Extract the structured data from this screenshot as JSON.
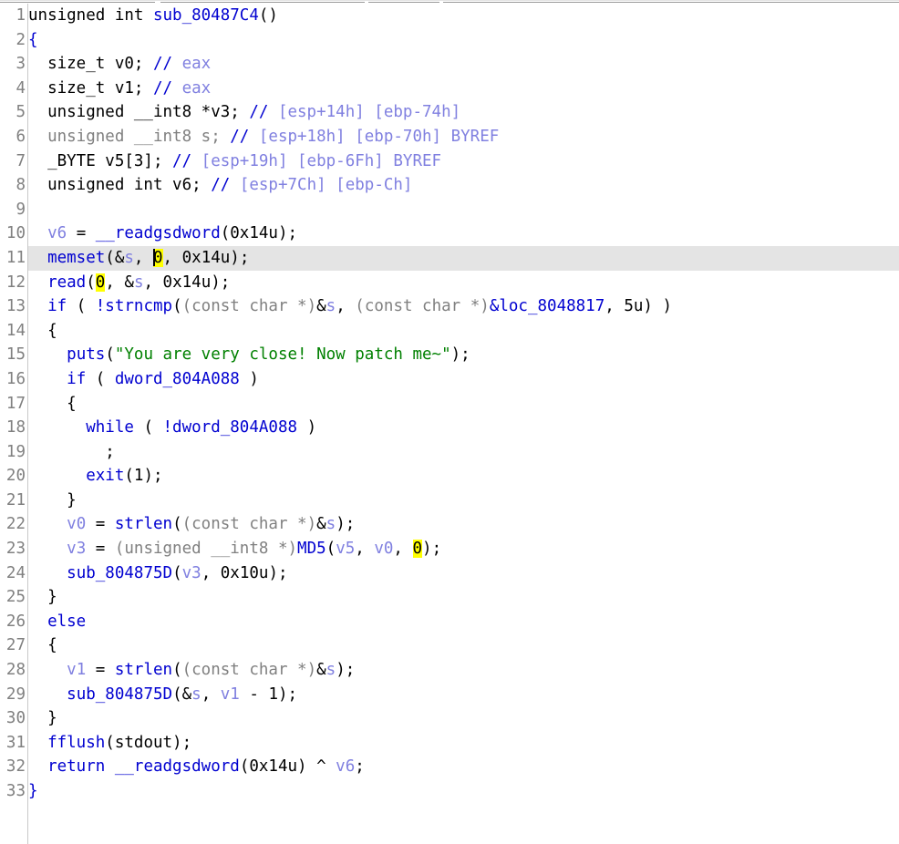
{
  "view": {
    "name": "pseudocode-view",
    "app": "IDA Pro Pseudocode",
    "function_signature": "unsigned int sub_80487C4()",
    "current_line": 11,
    "caret_line": 11,
    "caret_column": 15
  },
  "colors": {
    "background": "#ffffff",
    "keyword": "#0000d0",
    "function": "#0000d0",
    "local_variable": "#8080e0",
    "comment": "#8080e0",
    "cast_type": "#808080",
    "string": "#008000",
    "highlight_row": "#e4e4e4",
    "highlight_token": "#ffff00",
    "line_number": "#808080",
    "gutter_rule": "#c8c8c8"
  },
  "lines": [
    {
      "n": "1",
      "tokens": [
        {
          "t": "unsigned int ",
          "c": "plain"
        },
        {
          "t": "sub_80487C4",
          "c": "fn"
        },
        {
          "t": "()",
          "c": "plain"
        }
      ]
    },
    {
      "n": "2",
      "tokens": [
        {
          "t": "{",
          "c": "kw"
        }
      ]
    },
    {
      "n": "3",
      "tokens": [
        {
          "t": "  ",
          "c": "plain"
        },
        {
          "t": "size_t ",
          "c": "plain"
        },
        {
          "t": "v0",
          "c": "plain"
        },
        {
          "t": "; ",
          "c": "plain"
        },
        {
          "t": "// ",
          "c": "kw"
        },
        {
          "t": "eax",
          "c": "cmt"
        }
      ]
    },
    {
      "n": "4",
      "tokens": [
        {
          "t": "  ",
          "c": "plain"
        },
        {
          "t": "size_t ",
          "c": "plain"
        },
        {
          "t": "v1",
          "c": "plain"
        },
        {
          "t": "; ",
          "c": "plain"
        },
        {
          "t": "// ",
          "c": "kw"
        },
        {
          "t": "eax",
          "c": "cmt"
        }
      ]
    },
    {
      "n": "5",
      "tokens": [
        {
          "t": "  ",
          "c": "plain"
        },
        {
          "t": "unsigned __int8 *v3; ",
          "c": "plain"
        },
        {
          "t": "// ",
          "c": "kw"
        },
        {
          "t": "[esp+14h] [ebp-74h]",
          "c": "cmt"
        }
      ]
    },
    {
      "n": "6",
      "tokens": [
        {
          "t": "  ",
          "c": "plain"
        },
        {
          "t": "unsigned __int8 s; ",
          "c": "gray"
        },
        {
          "t": "// ",
          "c": "kw"
        },
        {
          "t": "[esp+18h] [ebp-70h] BYREF",
          "c": "cmt"
        }
      ]
    },
    {
      "n": "7",
      "tokens": [
        {
          "t": "  ",
          "c": "plain"
        },
        {
          "t": "_BYTE v5[3]; ",
          "c": "plain"
        },
        {
          "t": "// ",
          "c": "kw"
        },
        {
          "t": "[esp+19h] [ebp-6Fh] BYREF",
          "c": "cmt"
        }
      ]
    },
    {
      "n": "8",
      "tokens": [
        {
          "t": "  ",
          "c": "plain"
        },
        {
          "t": "unsigned int v6; ",
          "c": "plain"
        },
        {
          "t": "// ",
          "c": "kw"
        },
        {
          "t": "[esp+7Ch] [ebp-Ch]",
          "c": "cmt"
        }
      ]
    },
    {
      "n": "9",
      "tokens": [
        {
          "t": "",
          "c": "plain"
        }
      ]
    },
    {
      "n": "10",
      "tokens": [
        {
          "t": "  ",
          "c": "plain"
        },
        {
          "t": "v6",
          "c": "var"
        },
        {
          "t": " = ",
          "c": "plain"
        },
        {
          "t": "__readgsdword",
          "c": "kw"
        },
        {
          "t": "(0x14u);",
          "c": "plain"
        }
      ]
    },
    {
      "n": "11",
      "tokens": [
        {
          "t": "  ",
          "c": "plain"
        },
        {
          "t": "memset",
          "c": "kw"
        },
        {
          "t": "(&",
          "c": "plain"
        },
        {
          "t": "s",
          "c": "var"
        },
        {
          "t": ", ",
          "c": "plain"
        },
        {
          "t": "|",
          "c": "caret"
        },
        {
          "t": "0",
          "c": "hl"
        },
        {
          "t": ", 0x14u);",
          "c": "plain"
        }
      ]
    },
    {
      "n": "12",
      "tokens": [
        {
          "t": "  ",
          "c": "plain"
        },
        {
          "t": "read",
          "c": "kw"
        },
        {
          "t": "(",
          "c": "plain"
        },
        {
          "t": "0",
          "c": "hl"
        },
        {
          "t": ", &",
          "c": "plain"
        },
        {
          "t": "s",
          "c": "var"
        },
        {
          "t": ", 0x14u);",
          "c": "plain"
        }
      ]
    },
    {
      "n": "13",
      "tokens": [
        {
          "t": "  ",
          "c": "plain"
        },
        {
          "t": "if",
          "c": "kw"
        },
        {
          "t": " ( ",
          "c": "plain"
        },
        {
          "t": "!strncmp",
          "c": "kw"
        },
        {
          "t": "(",
          "c": "plain"
        },
        {
          "t": "(const char *)",
          "c": "cast"
        },
        {
          "t": "&",
          "c": "plain"
        },
        {
          "t": "s",
          "c": "var"
        },
        {
          "t": ", ",
          "c": "plain"
        },
        {
          "t": "(const char *)",
          "c": "cast"
        },
        {
          "t": "&loc_8048817",
          "c": "kw"
        },
        {
          "t": ", 5u) )",
          "c": "plain"
        }
      ]
    },
    {
      "n": "14",
      "tokens": [
        {
          "t": "  {",
          "c": "plain"
        }
      ]
    },
    {
      "n": "15",
      "tokens": [
        {
          "t": "    ",
          "c": "plain"
        },
        {
          "t": "puts",
          "c": "kw"
        },
        {
          "t": "(",
          "c": "plain"
        },
        {
          "t": "\"You are very close! Now patch me~\"",
          "c": "str"
        },
        {
          "t": ");",
          "c": "plain"
        }
      ]
    },
    {
      "n": "16",
      "tokens": [
        {
          "t": "    ",
          "c": "plain"
        },
        {
          "t": "if",
          "c": "kw"
        },
        {
          "t": " ( ",
          "c": "plain"
        },
        {
          "t": "dword_804A088",
          "c": "kw"
        },
        {
          "t": " )",
          "c": "plain"
        }
      ]
    },
    {
      "n": "17",
      "tokens": [
        {
          "t": "    {",
          "c": "plain"
        }
      ]
    },
    {
      "n": "18",
      "tokens": [
        {
          "t": "      ",
          "c": "plain"
        },
        {
          "t": "while",
          "c": "kw"
        },
        {
          "t": " ( ",
          "c": "plain"
        },
        {
          "t": "!dword_804A088",
          "c": "kw"
        },
        {
          "t": " )",
          "c": "plain"
        }
      ]
    },
    {
      "n": "19",
      "tokens": [
        {
          "t": "        ;",
          "c": "plain"
        }
      ]
    },
    {
      "n": "20",
      "tokens": [
        {
          "t": "      ",
          "c": "plain"
        },
        {
          "t": "exit",
          "c": "kw"
        },
        {
          "t": "(1);",
          "c": "plain"
        }
      ]
    },
    {
      "n": "21",
      "tokens": [
        {
          "t": "    }",
          "c": "plain"
        }
      ]
    },
    {
      "n": "22",
      "tokens": [
        {
          "t": "    ",
          "c": "plain"
        },
        {
          "t": "v0",
          "c": "var"
        },
        {
          "t": " = ",
          "c": "plain"
        },
        {
          "t": "strlen",
          "c": "kw"
        },
        {
          "t": "(",
          "c": "plain"
        },
        {
          "t": "(const char *)",
          "c": "cast"
        },
        {
          "t": "&",
          "c": "plain"
        },
        {
          "t": "s",
          "c": "var"
        },
        {
          "t": ");",
          "c": "plain"
        }
      ]
    },
    {
      "n": "23",
      "tokens": [
        {
          "t": "    ",
          "c": "plain"
        },
        {
          "t": "v3",
          "c": "var"
        },
        {
          "t": " = ",
          "c": "plain"
        },
        {
          "t": "(unsigned __int8 *)",
          "c": "cast"
        },
        {
          "t": "MD5",
          "c": "kw"
        },
        {
          "t": "(",
          "c": "plain"
        },
        {
          "t": "v5",
          "c": "var"
        },
        {
          "t": ", ",
          "c": "plain"
        },
        {
          "t": "v0",
          "c": "var"
        },
        {
          "t": ", ",
          "c": "plain"
        },
        {
          "t": "0",
          "c": "hl"
        },
        {
          "t": ");",
          "c": "plain"
        }
      ]
    },
    {
      "n": "24",
      "tokens": [
        {
          "t": "    ",
          "c": "plain"
        },
        {
          "t": "sub_804875D",
          "c": "kw"
        },
        {
          "t": "(",
          "c": "plain"
        },
        {
          "t": "v3",
          "c": "var"
        },
        {
          "t": ", 0x10u);",
          "c": "plain"
        }
      ]
    },
    {
      "n": "25",
      "tokens": [
        {
          "t": "  }",
          "c": "plain"
        }
      ]
    },
    {
      "n": "26",
      "tokens": [
        {
          "t": "  ",
          "c": "plain"
        },
        {
          "t": "else",
          "c": "kw"
        }
      ]
    },
    {
      "n": "27",
      "tokens": [
        {
          "t": "  {",
          "c": "plain"
        }
      ]
    },
    {
      "n": "28",
      "tokens": [
        {
          "t": "    ",
          "c": "plain"
        },
        {
          "t": "v1",
          "c": "var"
        },
        {
          "t": " = ",
          "c": "plain"
        },
        {
          "t": "strlen",
          "c": "kw"
        },
        {
          "t": "(",
          "c": "plain"
        },
        {
          "t": "(const char *)",
          "c": "cast"
        },
        {
          "t": "&",
          "c": "plain"
        },
        {
          "t": "s",
          "c": "var"
        },
        {
          "t": ");",
          "c": "plain"
        }
      ]
    },
    {
      "n": "29",
      "tokens": [
        {
          "t": "    ",
          "c": "plain"
        },
        {
          "t": "sub_804875D",
          "c": "kw"
        },
        {
          "t": "(&",
          "c": "plain"
        },
        {
          "t": "s",
          "c": "var"
        },
        {
          "t": ", ",
          "c": "plain"
        },
        {
          "t": "v1",
          "c": "var"
        },
        {
          "t": " - 1);",
          "c": "plain"
        }
      ]
    },
    {
      "n": "30",
      "tokens": [
        {
          "t": "  }",
          "c": "plain"
        }
      ]
    },
    {
      "n": "31",
      "tokens": [
        {
          "t": "  ",
          "c": "plain"
        },
        {
          "t": "fflush",
          "c": "kw"
        },
        {
          "t": "(stdout);",
          "c": "plain"
        }
      ]
    },
    {
      "n": "32",
      "tokens": [
        {
          "t": "  ",
          "c": "plain"
        },
        {
          "t": "return",
          "c": "kw"
        },
        {
          "t": " ",
          "c": "plain"
        },
        {
          "t": "__readgsdword",
          "c": "kw"
        },
        {
          "t": "(0x14u) ^ ",
          "c": "plain"
        },
        {
          "t": "v6",
          "c": "var"
        },
        {
          "t": ";",
          "c": "plain"
        }
      ]
    },
    {
      "n": "33",
      "tokens": [
        {
          "t": "}",
          "c": "kw"
        }
      ]
    }
  ]
}
